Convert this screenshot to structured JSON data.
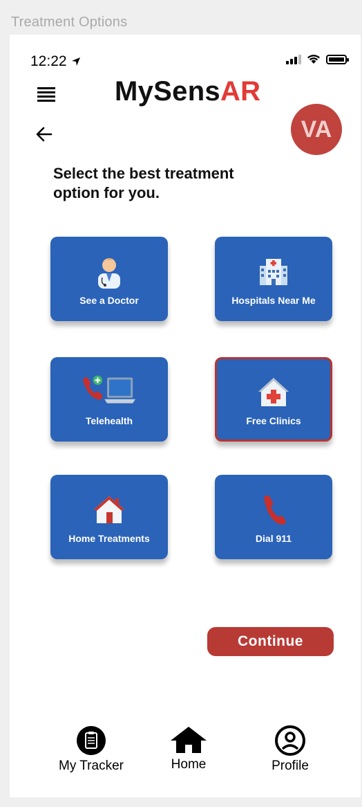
{
  "artboard": {
    "title": "Treatment Options"
  },
  "status_bar": {
    "time": "12:22"
  },
  "header": {
    "logo_main": "MySens",
    "logo_accent": "AR"
  },
  "avatar": {
    "initials": "VA"
  },
  "prompt": "Select the best treatment option for you.",
  "options": [
    {
      "label": "See a Doctor",
      "icon": "doctor-icon"
    },
    {
      "label": "Hospitals Near Me",
      "icon": "hospital-icon"
    },
    {
      "label": "Telehealth",
      "icon": "telehealth-icon"
    },
    {
      "label": "Free Clinics",
      "icon": "clinic-icon",
      "selected": true
    },
    {
      "label": "Home Treatments",
      "icon": "house-icon"
    },
    {
      "label": "Dial 911",
      "icon": "phone-icon"
    }
  ],
  "continue_label": "Continue",
  "bottom_nav": [
    {
      "label": "My Tracker",
      "icon": "clipboard-icon"
    },
    {
      "label": "Home",
      "icon": "home-icon"
    },
    {
      "label": "Profile",
      "icon": "profile-icon"
    }
  ],
  "colors": {
    "tile": "#2a63b8",
    "accent": "#b83a34",
    "logo_accent": "#e23b36"
  }
}
